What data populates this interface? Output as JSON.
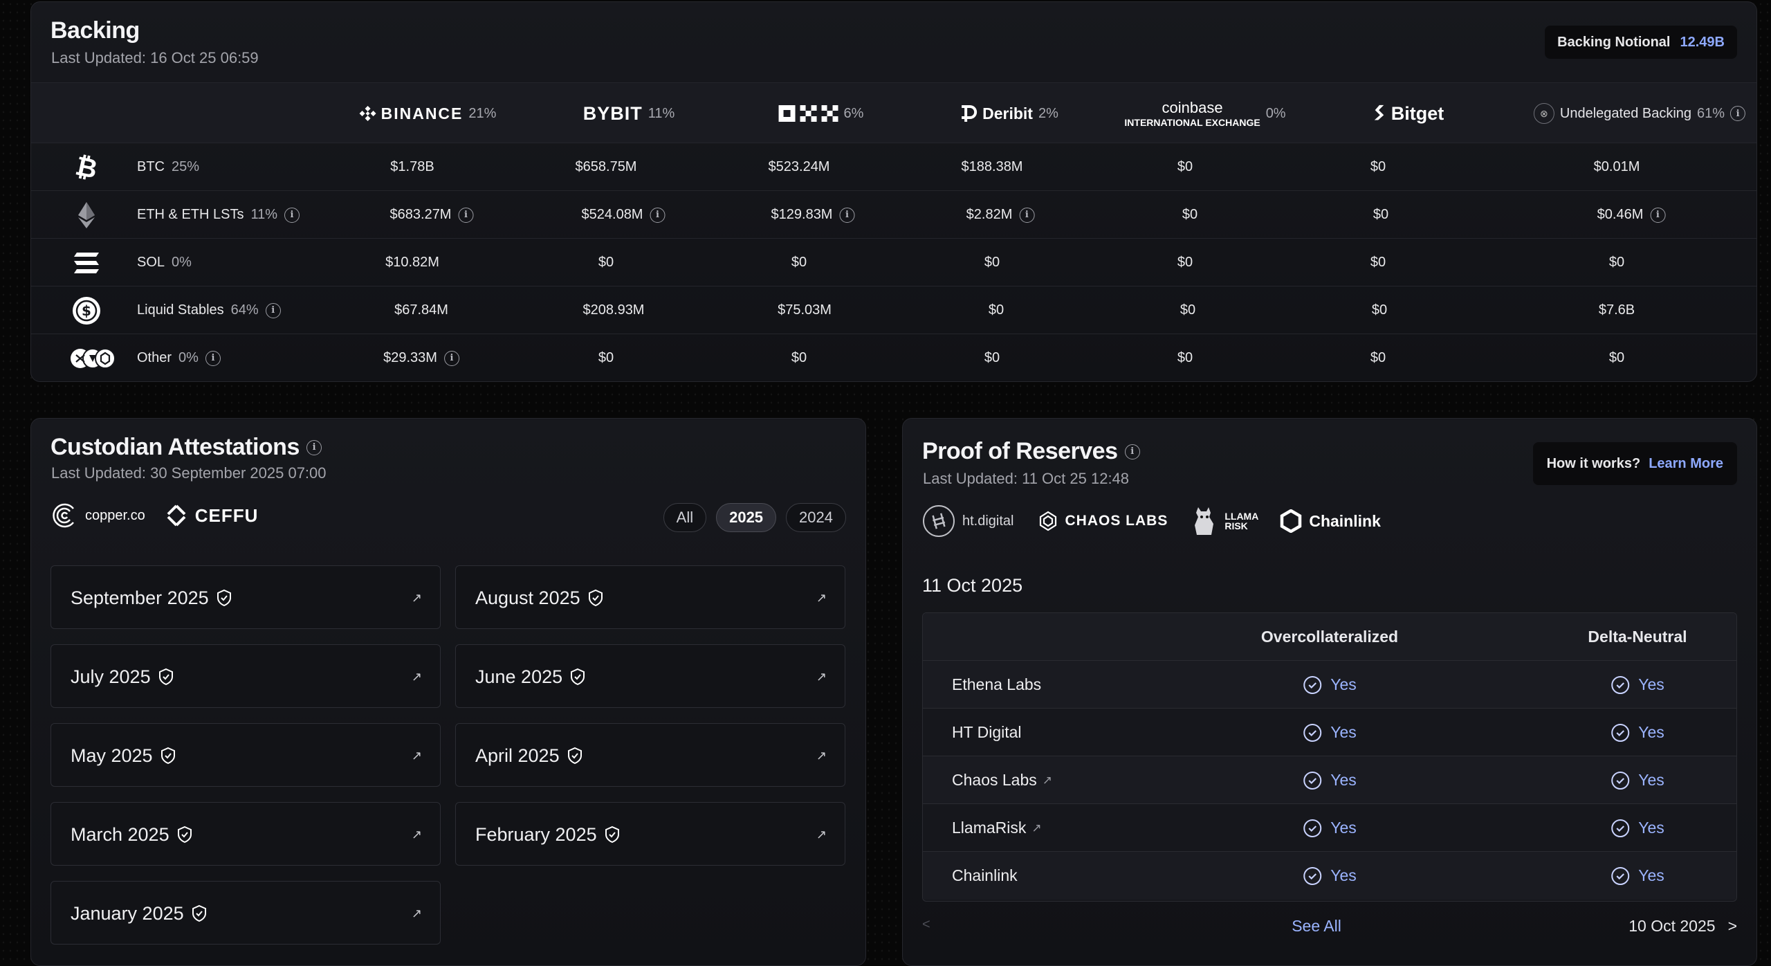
{
  "backing": {
    "title": "Backing",
    "updated": "Last Updated: 16 Oct 25 06:59",
    "notional_label": "Backing Notional",
    "notional_value": "12.49B",
    "exchanges": [
      {
        "name": "BINANCE",
        "pct": "21%"
      },
      {
        "name": "BYBIT",
        "pct": "11%"
      },
      {
        "name": "OKX",
        "pct": "6%"
      },
      {
        "name": "Deribit",
        "pct": "2%"
      },
      {
        "name": "coinbase",
        "sub": "INTERNATIONAL EXCHANGE",
        "pct": "0%"
      },
      {
        "name": "Bitget",
        "pct": ""
      },
      {
        "name": "Undelegated Backing",
        "pct": "61%"
      }
    ],
    "assets": [
      {
        "name": "BTC",
        "pct": "25%",
        "icon": "bitcoin-icon",
        "values": [
          "$1.78B",
          "$658.75M",
          "$523.24M",
          "$188.38M",
          "$0",
          "$0",
          "$0.01M"
        ]
      },
      {
        "name": "ETH & ETH LSTs",
        "pct": "11%",
        "icon": "ethereum-icon",
        "values": [
          "$683.27M",
          "$524.08M",
          "$129.83M",
          "$2.82M",
          "$0",
          "$0",
          "$0.46M"
        ]
      },
      {
        "name": "SOL",
        "pct": "0%",
        "icon": "solana-icon",
        "values": [
          "$10.82M",
          "$0",
          "$0",
          "$0",
          "$0",
          "$0",
          "$0"
        ]
      },
      {
        "name": "Liquid Stables",
        "pct": "64%",
        "icon": "stablecoin-icon",
        "values": [
          "$67.84M",
          "$208.93M",
          "$75.03M",
          "$0",
          "$0",
          "$0",
          "$7.6B"
        ]
      },
      {
        "name": "Other",
        "pct": "0%",
        "icon": "other-assets-icon",
        "values": [
          "$29.33M",
          "$0",
          "$0",
          "$0",
          "$0",
          "$0",
          "$0"
        ]
      }
    ]
  },
  "custodian": {
    "title": "Custodian Attestations",
    "updated": "Last Updated: 30 September 2025 07:00",
    "logos": [
      "copper.co",
      "CEFFU"
    ],
    "filters": [
      "All",
      "2025",
      "2024"
    ],
    "active_filter": "2025",
    "months": [
      "September 2025",
      "August 2025",
      "July 2025",
      "June 2025",
      "May 2025",
      "April 2025",
      "March 2025",
      "February 2025",
      "January 2025"
    ],
    "arrow": "↗"
  },
  "por": {
    "title": "Proof of Reserves",
    "updated": "Last Updated: 11 Oct 25 12:48",
    "how_label": "How it works?",
    "learn_more": "Learn More",
    "logos": [
      "ht.digital",
      "CHAOS LABS",
      "LLAMA RISK",
      "Chainlink"
    ],
    "date": "11 Oct 2025",
    "columns": [
      "Overcollateralized",
      "Delta-Neutral"
    ],
    "rows": [
      {
        "name": "Ethena Labs",
        "link": false,
        "values": [
          "Yes",
          "Yes"
        ]
      },
      {
        "name": "HT Digital",
        "link": false,
        "values": [
          "Yes",
          "Yes"
        ]
      },
      {
        "name": "Chaos Labs",
        "link": true,
        "values": [
          "Yes",
          "Yes"
        ]
      },
      {
        "name": "LlamaRisk",
        "link": true,
        "values": [
          "Yes",
          "Yes"
        ]
      },
      {
        "name": "Chainlink",
        "link": false,
        "values": [
          "Yes",
          "Yes"
        ]
      }
    ],
    "prev": "<",
    "see_all": "See All",
    "next_date": "10 Oct 2025",
    "next": ">"
  },
  "colors": {
    "accent": "#8ea9ff",
    "yes": "#9bb4ff"
  }
}
